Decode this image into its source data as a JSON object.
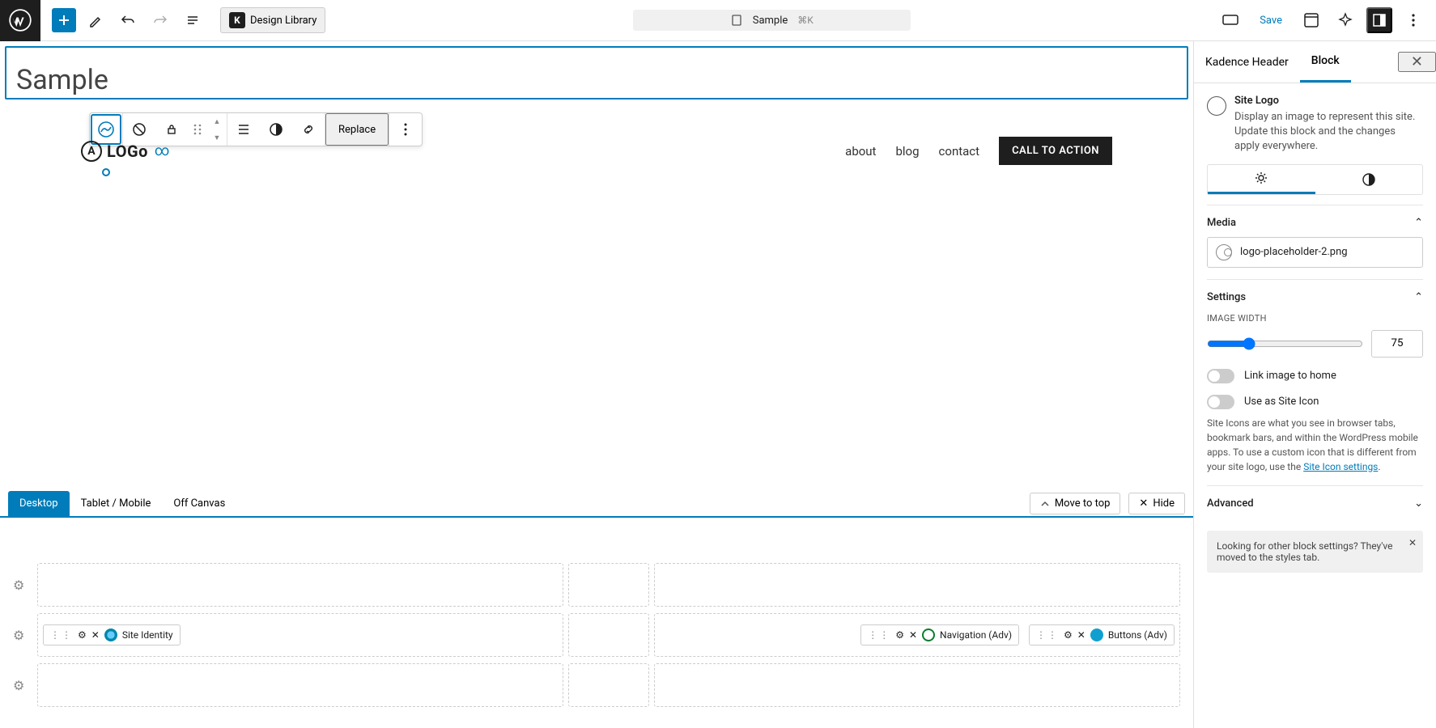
{
  "topbar": {
    "design_library": "Design Library",
    "doc_title": "Sample",
    "shortcut": "⌘K",
    "save": "Save"
  },
  "canvas": {
    "page_title": "Sample",
    "toolbar": {
      "replace": "Replace"
    },
    "preview": {
      "logo_text": "LOGo",
      "nav": [
        "about",
        "blog",
        "contact"
      ],
      "cta": "CALL TO ACTION"
    }
  },
  "device_tabs": {
    "desktop": "Desktop",
    "tablet": "Tablet / Mobile",
    "off_canvas": "Off Canvas",
    "move_to_top": "Move to top",
    "hide": "Hide"
  },
  "structure": {
    "site_identity": "Site Identity",
    "navigation": "Navigation (Adv)",
    "buttons": "Buttons (Adv)"
  },
  "sidebar": {
    "tab_header": "Kadence Header",
    "tab_block": "Block",
    "block_title": "Site Logo",
    "block_desc": "Display an image to represent this site. Update this block and the changes apply everywhere.",
    "media_section": "Media",
    "media_file": "logo-placeholder-2.png",
    "settings_section": "Settings",
    "image_width_label": "Image Width",
    "image_width_value": "75",
    "link_home": "Link image to home",
    "use_as_icon": "Use as Site Icon",
    "icon_help": "Site Icons are what you see in browser tabs, bookmark bars, and within the WordPress mobile apps. To use a custom icon that is different from your site logo, use the ",
    "icon_help_link": "Site Icon settings",
    "icon_help_suffix": ".",
    "advanced_section": "Advanced",
    "notice": "Looking for other block settings? They've moved to the styles tab."
  }
}
